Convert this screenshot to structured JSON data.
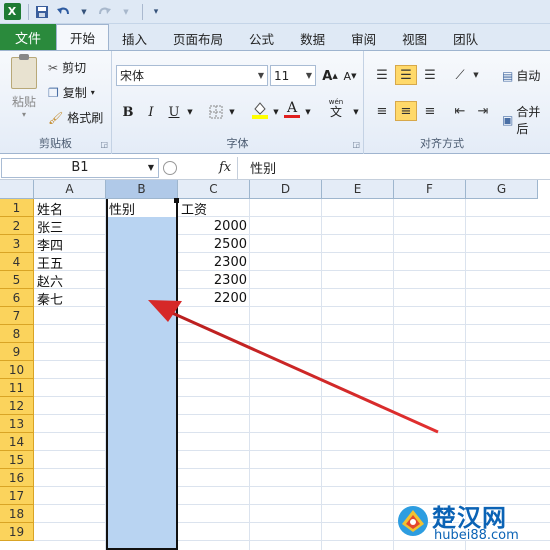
{
  "qat": {
    "logo": "X",
    "icons": [
      "excel-logo-icon",
      "save-icon",
      "undo-icon",
      "redo-icon",
      "customize-icon"
    ]
  },
  "tabs": [
    "文件",
    "开始",
    "插入",
    "页面布局",
    "公式",
    "数据",
    "审阅",
    "视图",
    "团队"
  ],
  "active_tab": "开始",
  "ribbon": {
    "clipboard": {
      "paste": "粘贴",
      "cut": "剪切",
      "copy": "复制",
      "format_painter": "格式刷",
      "label": "剪贴板"
    },
    "font": {
      "font_name": "宋体",
      "font_size": "11",
      "bold": "B",
      "italic": "I",
      "underline": "U",
      "grow": "A",
      "shrink": "A",
      "phonetic": "wén",
      "phonetic2": "文",
      "font_color_letter": "A",
      "label": "字体"
    },
    "alignment": {
      "wrap": "自动",
      "merge": "合并后",
      "label": "对齐方式"
    }
  },
  "formula_bar": {
    "name_box": "B1",
    "fx": "fx",
    "content": "性别"
  },
  "columns": [
    "A",
    "B",
    "C",
    "D",
    "E",
    "F",
    "G"
  ],
  "selected_column": "B",
  "rows": [
    "1",
    "2",
    "3",
    "4",
    "5",
    "6",
    "7",
    "8",
    "9",
    "10",
    "11",
    "12",
    "13",
    "14",
    "15",
    "16",
    "17",
    "18",
    "19"
  ],
  "cells": {
    "A": [
      "姓名",
      "张三",
      "李四",
      "王五",
      "赵六",
      "秦七"
    ],
    "B": [
      "性别"
    ],
    "C": [
      "工资",
      "2000",
      "2500",
      "2300",
      "2300",
      "2200"
    ]
  },
  "watermark": {
    "title": "楚汉网",
    "url": "hubei88.com"
  },
  "colors": {
    "file_tab": "#2a8a3c",
    "row_header": "#fbd35c",
    "selection": "#b9d4f2",
    "arrow": "#d93434"
  }
}
